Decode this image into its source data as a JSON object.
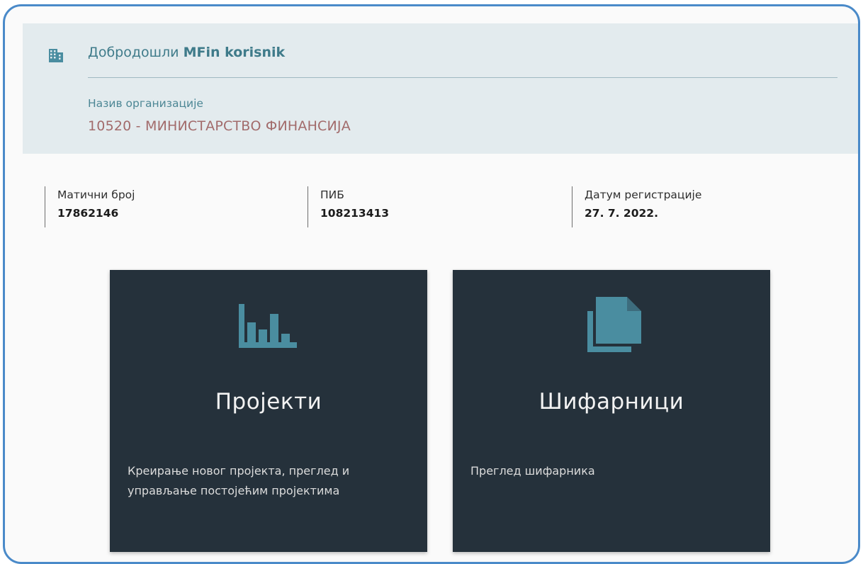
{
  "header": {
    "greeting_prefix": "Добродошли",
    "username": "MFin korisnik",
    "icon": "building-icon"
  },
  "organization": {
    "label": "Назив организације",
    "value": "10520 - МИНИСТАРСТВО ФИНАНСИЈА"
  },
  "info": [
    {
      "label": "Матични број",
      "value": "17862146"
    },
    {
      "label": "ПИБ",
      "value": "108213413"
    },
    {
      "label": "Датум регистрације",
      "value": "27. 7. 2022."
    }
  ],
  "cards": [
    {
      "title": "Пројекти",
      "description": "Креирање новог пројекта, преглед и управљање постојећим пројектима",
      "icon": "bar-chart-icon"
    },
    {
      "title": "Шифарници",
      "description": "Преглед шифарника",
      "icon": "file-copy-icon"
    }
  ],
  "colors": {
    "accent": "#4a8da0",
    "card_bg": "#25313b",
    "welcome_bg": "#e3ebee",
    "org_value": "#a26b6b",
    "frame_border": "#4a8ac9"
  }
}
